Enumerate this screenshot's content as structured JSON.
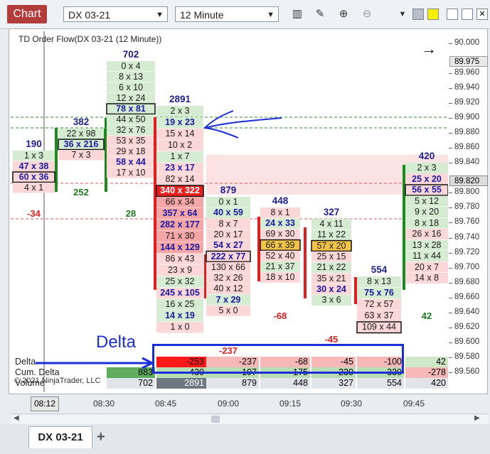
{
  "toolbar": {
    "chart_label": "Chart",
    "instrument": "DX 03-21",
    "interval": "12 Minute"
  },
  "chart": {
    "title": "TD Order Flow(DX 03-21 (12 Minute))",
    "cursor_time": "08:12",
    "price_marker": "89.975",
    "last_price": "89.820",
    "copyright": "© 2021 NinjaTrader, LLC",
    "annotation": "Delta"
  },
  "price_axis": [
    "90.000",
    "89.960",
    "89.940",
    "89.920",
    "89.900",
    "89.880",
    "89.860",
    "89.840",
    "89.800",
    "89.780",
    "89.760",
    "89.740",
    "89.720",
    "89.700",
    "89.680",
    "89.660",
    "89.640",
    "89.620",
    "89.600",
    "89.580",
    "89.560"
  ],
  "time_axis": [
    "08:30",
    "08:45",
    "09:00",
    "09:15",
    "09:30",
    "09:45"
  ],
  "bars": [
    {
      "total": "190",
      "delta": "-34",
      "cells": [
        "1 x 3",
        "47 x 38",
        "60 x 36",
        "4 x 1"
      ]
    },
    {
      "total": "382",
      "delta": "252",
      "cells": [
        "22 x 98",
        "36 x 216",
        "7 x 3"
      ]
    },
    {
      "total": "702",
      "delta": "28",
      "cells": [
        "0 x 4",
        "8 x 13",
        "6 x 10",
        "12 x 24",
        "78 x 81",
        "44 x 50",
        "32 x 76",
        "53 x 35",
        "29 x 18",
        "58 x 44",
        "17 x 10"
      ]
    },
    {
      "total": "2891",
      "delta": "",
      "cells": [
        "2 x 3",
        "19 x 23",
        "15 x 14",
        "10 x 2",
        "1 x 7",
        "23 x 17",
        "82 x 14",
        "340 x 322",
        "66 x 34",
        "357 x 64",
        "282 x 177",
        "71 x 30",
        "144 x 129",
        "86 x 43",
        "23 x 9",
        "25 x 32",
        "245 x 105",
        "16 x 25",
        "14 x 19",
        "1 x 0"
      ]
    },
    {
      "total": "879",
      "delta": "-237",
      "cells": [
        "0 x 1",
        "40 x 59",
        "8 x 7",
        "20 x 17",
        "54 x 27",
        "222 x 77",
        "130 x 66",
        "32 x 26",
        "40 x 12",
        "7 x 29",
        "5 x 0"
      ]
    },
    {
      "total": "448",
      "delta": "-68",
      "cells": [
        "8 x 1",
        "24 x 33",
        "69 x 30",
        "66 x 39",
        "52 x 40",
        "21 x 37",
        "18 x 10"
      ]
    },
    {
      "total": "327",
      "delta": "-45",
      "cells": [
        "4 x 11",
        "11 x 22",
        "57 x 20",
        "25 x 15",
        "21 x 22",
        "35 x 21",
        "30 x 24",
        "3 x 6"
      ]
    },
    {
      "total": "554",
      "delta": "",
      "cells": [
        "8 x 13",
        "75 x 76",
        "72 x 57",
        "63 x 37",
        "109 x 44"
      ]
    },
    {
      "total": "420",
      "delta": "42",
      "cells": [
        "2 x 3",
        "25 x 20",
        "56 x 55",
        "5 x 12",
        "9 x 20",
        "8 x 18",
        "26 x 16",
        "13 x 28",
        "11 x 44",
        "20 x 7",
        "14 x 8"
      ]
    }
  ],
  "rows": {
    "delta": {
      "label": "Delta",
      "values": [
        "",
        "",
        "",
        "-253",
        "-237",
        "-68",
        "-45",
        "-100",
        "42"
      ]
    },
    "cum_delta": {
      "label": "Cum. Delta",
      "values": [
        "",
        "",
        "883",
        "430",
        "197",
        "175",
        "230",
        "330",
        "-278"
      ]
    },
    "volume": {
      "label": "Volume",
      "values": [
        "",
        "",
        "702",
        "2891",
        "879",
        "448",
        "327",
        "554",
        "420"
      ]
    }
  },
  "tabs": {
    "active": "DX 03-21",
    "add": "+"
  },
  "colors": {
    "buy": "#1d7a1d",
    "sell": "#e02020",
    "accent": "#1a2ed8",
    "chart_button": "#b23b3b"
  }
}
